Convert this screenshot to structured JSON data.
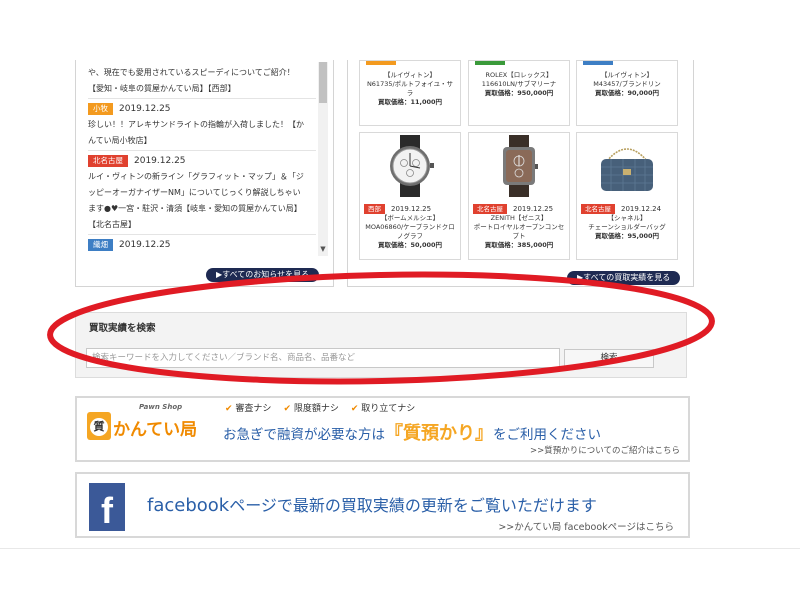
{
  "news": {
    "items": [
      {
        "tag": "",
        "tag_color": "",
        "date": "",
        "lines": [
          "や、現在でも愛用されているスピーディについてご紹介！",
          "【愛知・岐阜の質屋かんてい局】【西部】"
        ]
      },
      {
        "tag": "小牧",
        "tag_color": "#f39a1f",
        "date": "2019.12.25",
        "lines": [
          "珍しい！！アレキサンドライトの指輪が入荷しました！【か",
          "んてい局小牧店】"
        ]
      },
      {
        "tag": "北名古屋",
        "tag_color": "#e0412f",
        "date": "2019.12.25",
        "lines": [
          "ルイ・ヴィトンの新ライン「グラフィット・マップ」＆「ジ",
          "ッピーオーガナイザーNM」についてじっくり解説しちゃい",
          "ます●♥一宮・駐沢・清須【岐阜・愛知の質屋かんてい局】",
          "【北名古屋】"
        ]
      },
      {
        "tag": "織畑",
        "tag_color": "#3d7ec4",
        "date": "2019.12.25",
        "lines": []
      }
    ],
    "more_label": "▶すべてのお知らせを見る"
  },
  "products": {
    "top_row": [
      {
        "tag_color": "#f39a1f",
        "lines": [
          "【ルイヴィトン】",
          "N61735/ポルトフォイユ・サ",
          "ラ"
        ],
        "price": "買取価格：11,000円"
      },
      {
        "tag_color": "#3a9a3a",
        "lines": [
          "ROLEX【ロレックス】",
          "116610LN/サブマリーナ"
        ],
        "price": "買取価格：950,000円"
      },
      {
        "tag_color": "#3d7ec4",
        "lines": [
          "【ルイヴィトン】",
          "M43457/ブランドリン"
        ],
        "price": "買取価格：90,000円"
      }
    ],
    "bottom_row": [
      {
        "tag": "西部",
        "tag_color": "#e0412f",
        "date": "2019.12.25",
        "image": "chronograph-watch",
        "lines": [
          "【ボームメルシエ】",
          "MOA06860/ケープランドクロ",
          "ノグラフ"
        ],
        "price": "買取価格：50,000円"
      },
      {
        "tag": "北名古屋",
        "tag_color": "#e0412f",
        "date": "2019.12.25",
        "image": "square-watch",
        "lines": [
          "ZENITH【ゼニス】",
          "ポートロイヤルオープンコンセ",
          "プト"
        ],
        "price": "買取価格：385,000円"
      },
      {
        "tag": "北名古屋",
        "tag_color": "#e0412f",
        "date": "2019.12.24",
        "image": "chain-bag",
        "lines": [
          "【シャネル】",
          "チェーンショルダーバッグ"
        ],
        "price": "買取価格：95,000円"
      }
    ],
    "more_label": "▶すべての買取実績を見る"
  },
  "search": {
    "title": "買取実績を検索",
    "placeholder": "検索キーワードを入力してください／ブランド名、商品名、品番など",
    "value": "",
    "button_label": "検索"
  },
  "pawn_banner": {
    "brand": "かんてい局",
    "pawn_shop": "Pawn Shop",
    "icon_char": "質",
    "checks": [
      "審査ナシ",
      "限度額ナシ",
      "取り立てナシ"
    ],
    "message_pre": "お急ぎで融資が必要な方は",
    "highlight": "『質預かり』",
    "message_post": "をご利用ください",
    "sub_link": ">>質預かりについてのご紹介はこちら"
  },
  "facebook_banner": {
    "logo_letter": "f",
    "message_brand": "facebook",
    "message_rest": "ページで最新の買取実績の更新をご覧いただけます",
    "sub_link": ">>かんてい局 facebookページはこちら"
  },
  "colors": {
    "annotation_red": "#e01b24",
    "navy": "#1e2a52",
    "facebook_blue": "#3b5998",
    "pawn_orange": "#f5a623",
    "text_blue": "#2a5fa8"
  }
}
